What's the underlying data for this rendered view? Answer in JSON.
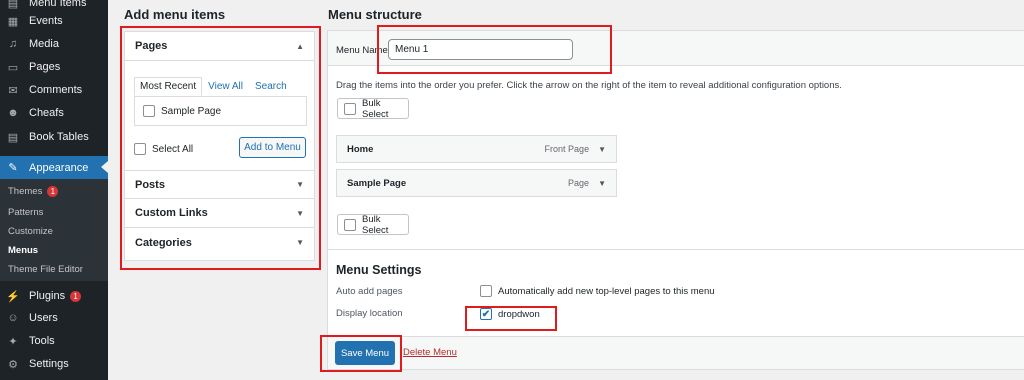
{
  "sidebar": {
    "items": [
      {
        "label": "Menu Items",
        "icon": "menu-items-icon",
        "glyph": "▤"
      },
      {
        "label": "Events",
        "icon": "events-icon",
        "glyph": "▦"
      },
      {
        "label": "Media",
        "icon": "media-icon",
        "glyph": "♫"
      },
      {
        "label": "Pages",
        "icon": "pages-icon",
        "glyph": "▭"
      },
      {
        "label": "Comments",
        "icon": "comments-icon",
        "glyph": "✉"
      },
      {
        "label": "Cheafs",
        "icon": "cheafs-icon",
        "glyph": "☻"
      },
      {
        "label": "Book Tables",
        "icon": "book-tables-icon",
        "glyph": "▤"
      },
      {
        "label": "Appearance",
        "icon": "appearance-icon",
        "glyph": "✎"
      }
    ],
    "submenu": [
      {
        "label": "Themes",
        "badge": "1"
      },
      {
        "label": "Patterns"
      },
      {
        "label": "Customize"
      },
      {
        "label": "Menus"
      },
      {
        "label": "Theme File Editor"
      }
    ],
    "lower_items": [
      {
        "label": "Plugins",
        "icon": "plugins-icon",
        "glyph": "⚡",
        "badge": "1"
      },
      {
        "label": "Users",
        "icon": "users-icon",
        "glyph": "☺"
      },
      {
        "label": "Tools",
        "icon": "tools-icon",
        "glyph": "✦"
      },
      {
        "label": "Settings",
        "icon": "settings-icon",
        "glyph": "⚙"
      }
    ]
  },
  "add_items": {
    "heading": "Add menu items",
    "sections": {
      "pages": "Pages",
      "posts": "Posts",
      "custom_links": "Custom Links",
      "categories": "Categories"
    },
    "tabs": [
      "Most Recent",
      "View All",
      "Search"
    ],
    "page_option": "Sample Page",
    "select_all": "Select All",
    "add_button": "Add to Menu"
  },
  "structure": {
    "heading": "Menu structure",
    "menu_name_label": "Menu Name",
    "menu_name_value": "Menu 1",
    "instructions": "Drag the items into the order you prefer. Click the arrow on the right of the item to reveal additional configuration options.",
    "bulk_select": "Bulk Select",
    "items": [
      {
        "title": "Home",
        "type": "Front Page"
      },
      {
        "title": "Sample Page",
        "type": "Page"
      }
    ]
  },
  "settings": {
    "title": "Menu Settings",
    "auto_add_label": "Auto add pages",
    "auto_add_option": "Automatically add new top-level pages to this menu",
    "display_location_label": "Display location",
    "location_option": "dropdwon",
    "location_checked": true
  },
  "footer": {
    "save": "Save Menu",
    "delete": "Delete Menu"
  },
  "colors": {
    "sidebar_bg": "#1d2327",
    "accent": "#2271b1",
    "annotation": "#e11b1b",
    "delete": "#b32d2e"
  }
}
